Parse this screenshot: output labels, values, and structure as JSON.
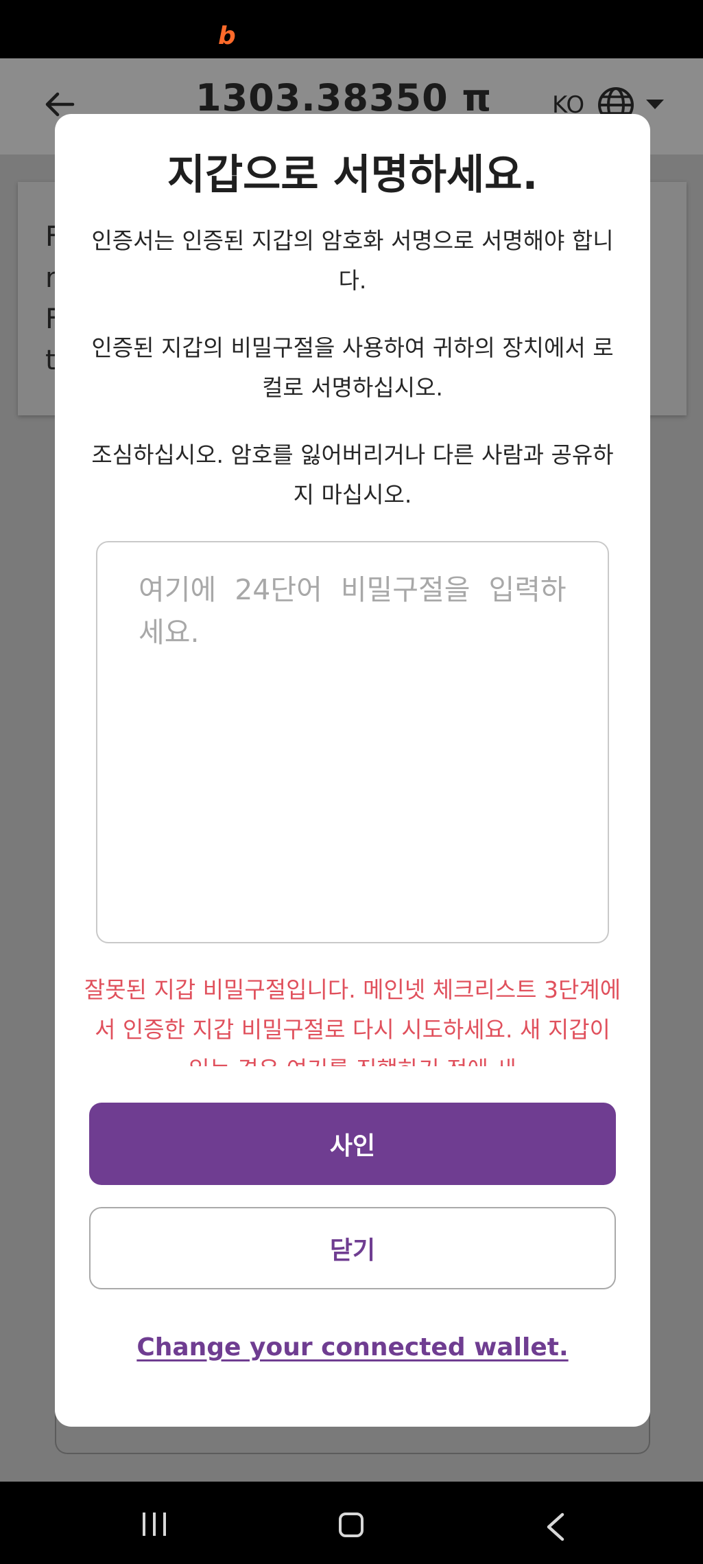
{
  "status_bar": {
    "app_badge": "b"
  },
  "background": {
    "balance": "1303.38350 π",
    "language": "KO",
    "card_letters": [
      "F",
      "n",
      "F",
      "t"
    ]
  },
  "modal": {
    "title": "지갑으로 서명하세요.",
    "paragraphs": [
      "인증서는 인증된 지갑의 암호화 서명으로 서명해야 합니다.",
      "인증된 지갑의 비밀구절을 사용하여 귀하의 장치에서 로컬로 서명하십시오.",
      "조심하십시오. 암호를 잃어버리거나 다른 사람과 공유하지 마십시오."
    ],
    "phrase_input": {
      "placeholder": "여기에 24단어 비밀구절을 입력하세요.",
      "value": ""
    },
    "error": "잘못된 지갑 비밀구절입니다. 메인넷 체크리스트 3단계에서 인증한 지갑 비밀구절로 다시 시도하세요. 새 지갑이 있는 경우 여기를 진행하기 전에 새",
    "sign_label": "사인",
    "close_label": "닫기",
    "change_wallet_label": "Change your connected wallet."
  },
  "colors": {
    "accent": "#6f3d91",
    "error": "#e0505c",
    "badge": "#ff6a2a"
  }
}
